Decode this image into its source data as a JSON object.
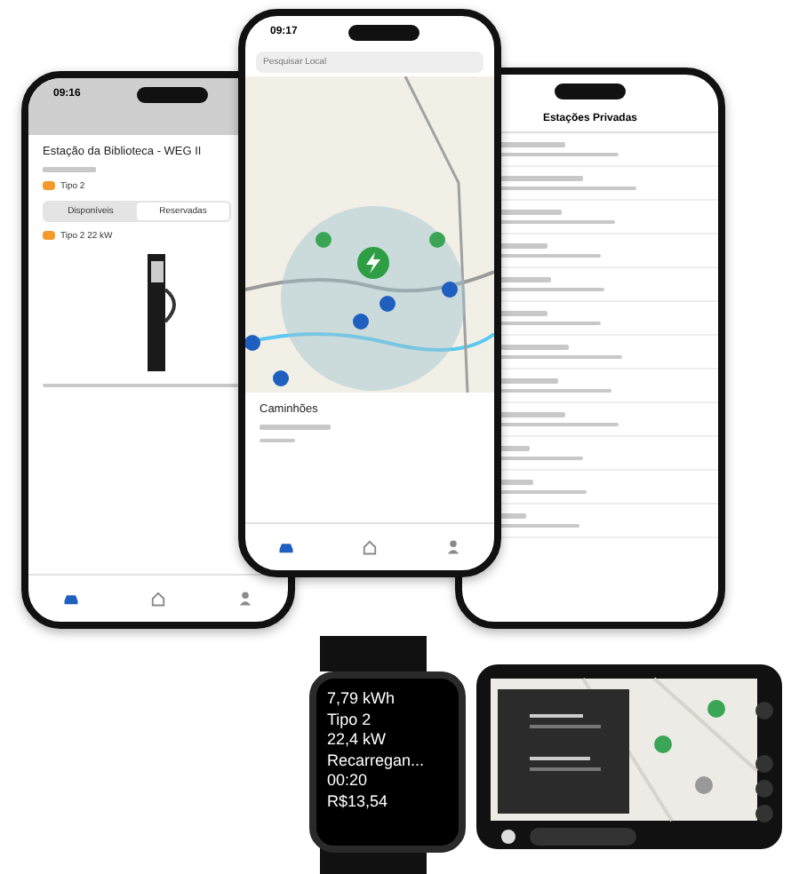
{
  "left_phone": {
    "time": "09:16",
    "title": "Estação da Biblioteca - WEG II",
    "connector": "Tipo 2",
    "segments": [
      {
        "label": "Disponíveis",
        "selected": false
      },
      {
        "label": "Reservadas",
        "selected": true
      }
    ],
    "connector_detail": "Tipo 2 22 kW",
    "tab_bar": [
      {
        "selected": true
      },
      {
        "selected": false
      },
      {
        "selected": false
      }
    ]
  },
  "center_phone": {
    "time": "09:17",
    "search": {
      "placeholder": "Pesquisar Local"
    },
    "sheet_title": "Caminhões",
    "tab_bar": [
      {
        "selected": true
      },
      {
        "selected": false
      },
      {
        "selected": false
      }
    ]
  },
  "right_phone": {
    "title": "Estações Privadas"
  },
  "watch": {
    "lines": [
      "7,79 kWh",
      "Tipo 2",
      "22,4 kW",
      "Recarregan...",
      "00:20",
      "R$13,54"
    ]
  }
}
